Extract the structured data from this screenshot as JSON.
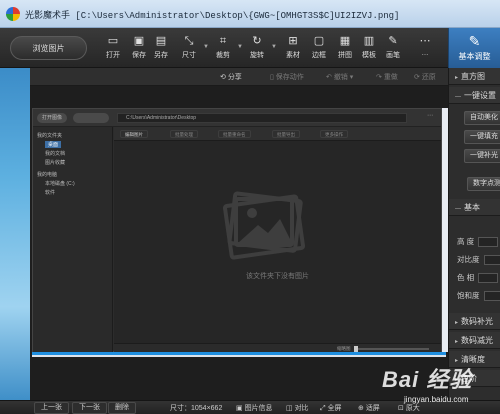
{
  "window": {
    "title": "光影魔术手 [C:\\Users\\Administrator\\Desktop\\{GWG~[OMHGT3S$C]UI2IZVJ.png]"
  },
  "toolbar": {
    "browse": "浏览图片",
    "tools": [
      {
        "label": "打开",
        "icon": "open-icon",
        "glyph": "▭"
      },
      {
        "label": "保存",
        "icon": "save-icon",
        "glyph": "▣"
      },
      {
        "label": "另存",
        "icon": "save-as-icon",
        "glyph": "▤"
      },
      {
        "label": "尺寸",
        "icon": "resize-icon",
        "glyph": "⤡"
      },
      {
        "label": "裁剪",
        "icon": "crop-icon",
        "glyph": "⌗"
      },
      {
        "label": "旋转",
        "icon": "rotate-icon",
        "glyph": "↻"
      },
      {
        "label": "素材",
        "icon": "material-icon",
        "glyph": "⊞"
      },
      {
        "label": "边框",
        "icon": "border-icon",
        "glyph": "▢"
      },
      {
        "label": "拼图",
        "icon": "collage-icon",
        "glyph": "▦"
      },
      {
        "label": "模板",
        "icon": "template-icon",
        "glyph": "▥"
      },
      {
        "label": "画笔",
        "icon": "brush-icon",
        "glyph": "✎"
      },
      {
        "label": "…",
        "icon": "more-icon",
        "glyph": "⋯"
      }
    ],
    "panel_tab": "基本调整"
  },
  "subbar": {
    "share": "分享",
    "save_action": "保存动作",
    "undo": "撤销",
    "redo": "重做",
    "restore": "还原"
  },
  "inner": {
    "open_btn": "打开图像",
    "path": "C:\\Users\\Administrator\\Desktop",
    "tree": {
      "fav": "我的文件夹",
      "desktop": "桌面",
      "docs": "我的文档",
      "pics": "图片收藏",
      "computer": "我的电脑",
      "disk_c": "本地磁盘 (C:)",
      "software": "软件"
    },
    "toolbar": [
      "编辑图片",
      "批量处理",
      "批量重命名",
      "批量导出",
      "更多操作"
    ],
    "empty_text": "该文件夹下没有图片",
    "zoom_label": "缩略图"
  },
  "right_panel": {
    "sections": [
      "直方图",
      "一键设置",
      "基本",
      "数码补光",
      "数码减光",
      "清晰度",
      "色阶"
    ],
    "buttons": [
      "自动美化",
      "一键填充",
      "一键补光",
      "数字点测光"
    ],
    "rows": [
      "高 度",
      "对比度",
      "色 相",
      "饱和度"
    ]
  },
  "bottombar": {
    "prev": "上一张",
    "next": "下一张",
    "delete": "删除",
    "size": "尺寸：1054×662",
    "info": "图片信息",
    "compare": "对比",
    "fullscreen": "全屏",
    "fit": "适屏",
    "original": "原大"
  },
  "watermark": {
    "brand": "Bai 经验",
    "site": "jingyan.baidu.com"
  }
}
